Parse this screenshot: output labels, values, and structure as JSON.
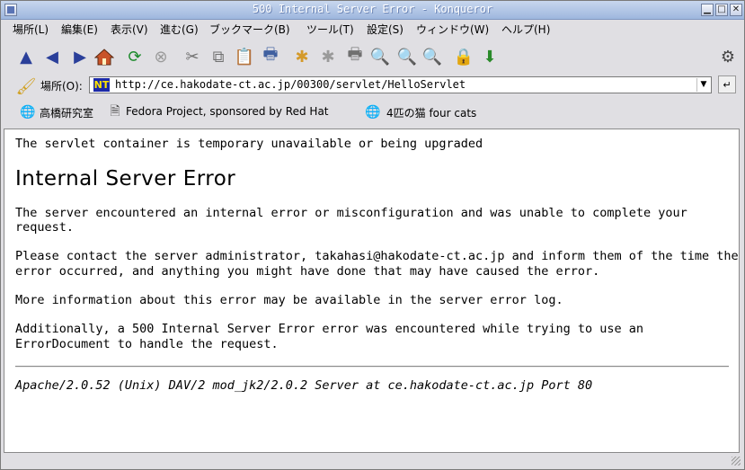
{
  "window": {
    "title": "500 Internal Server Error - Konqueror"
  },
  "menu": [
    "場所(L)",
    "編集(E)",
    "表示(V)",
    "進む(G)",
    "ブックマーク(B)",
    "ツール(T)",
    "設定(S)",
    "ウィンドウ(W)",
    "ヘルプ(H)"
  ],
  "location": {
    "label": "場所(O):",
    "url": "http://ce.hakodate-ct.ac.jp/00300/servlet/HelloServlet"
  },
  "bookmarks": [
    "高橋研究室",
    "Fedora Project, sponsored by Red Hat",
    "4匹の猫 four cats"
  ],
  "page": {
    "notice": "The servlet container is temporary unavailable or being upgraded",
    "heading": "Internal Server Error",
    "p1a": "The server encountered an internal error or misconfiguration and was unable to complete your",
    "p1b": "request.",
    "p2a": "Please contact the server administrator, takahasi@hakodate-ct.ac.jp and inform them of the time the",
    "p2b": "error occurred, and anything you might have done that may have caused the error.",
    "p3": "More information about this error may be available in the server error log.",
    "p4a": "Additionally, a 500 Internal Server Error error was encountered while trying to use an",
    "p4b": "ErrorDocument to handle the request.",
    "address": "Apache/2.0.52 (Unix) DAV/2 mod_jk2/2.0.2 Server at ce.hakodate-ct.ac.jp Port 80"
  }
}
